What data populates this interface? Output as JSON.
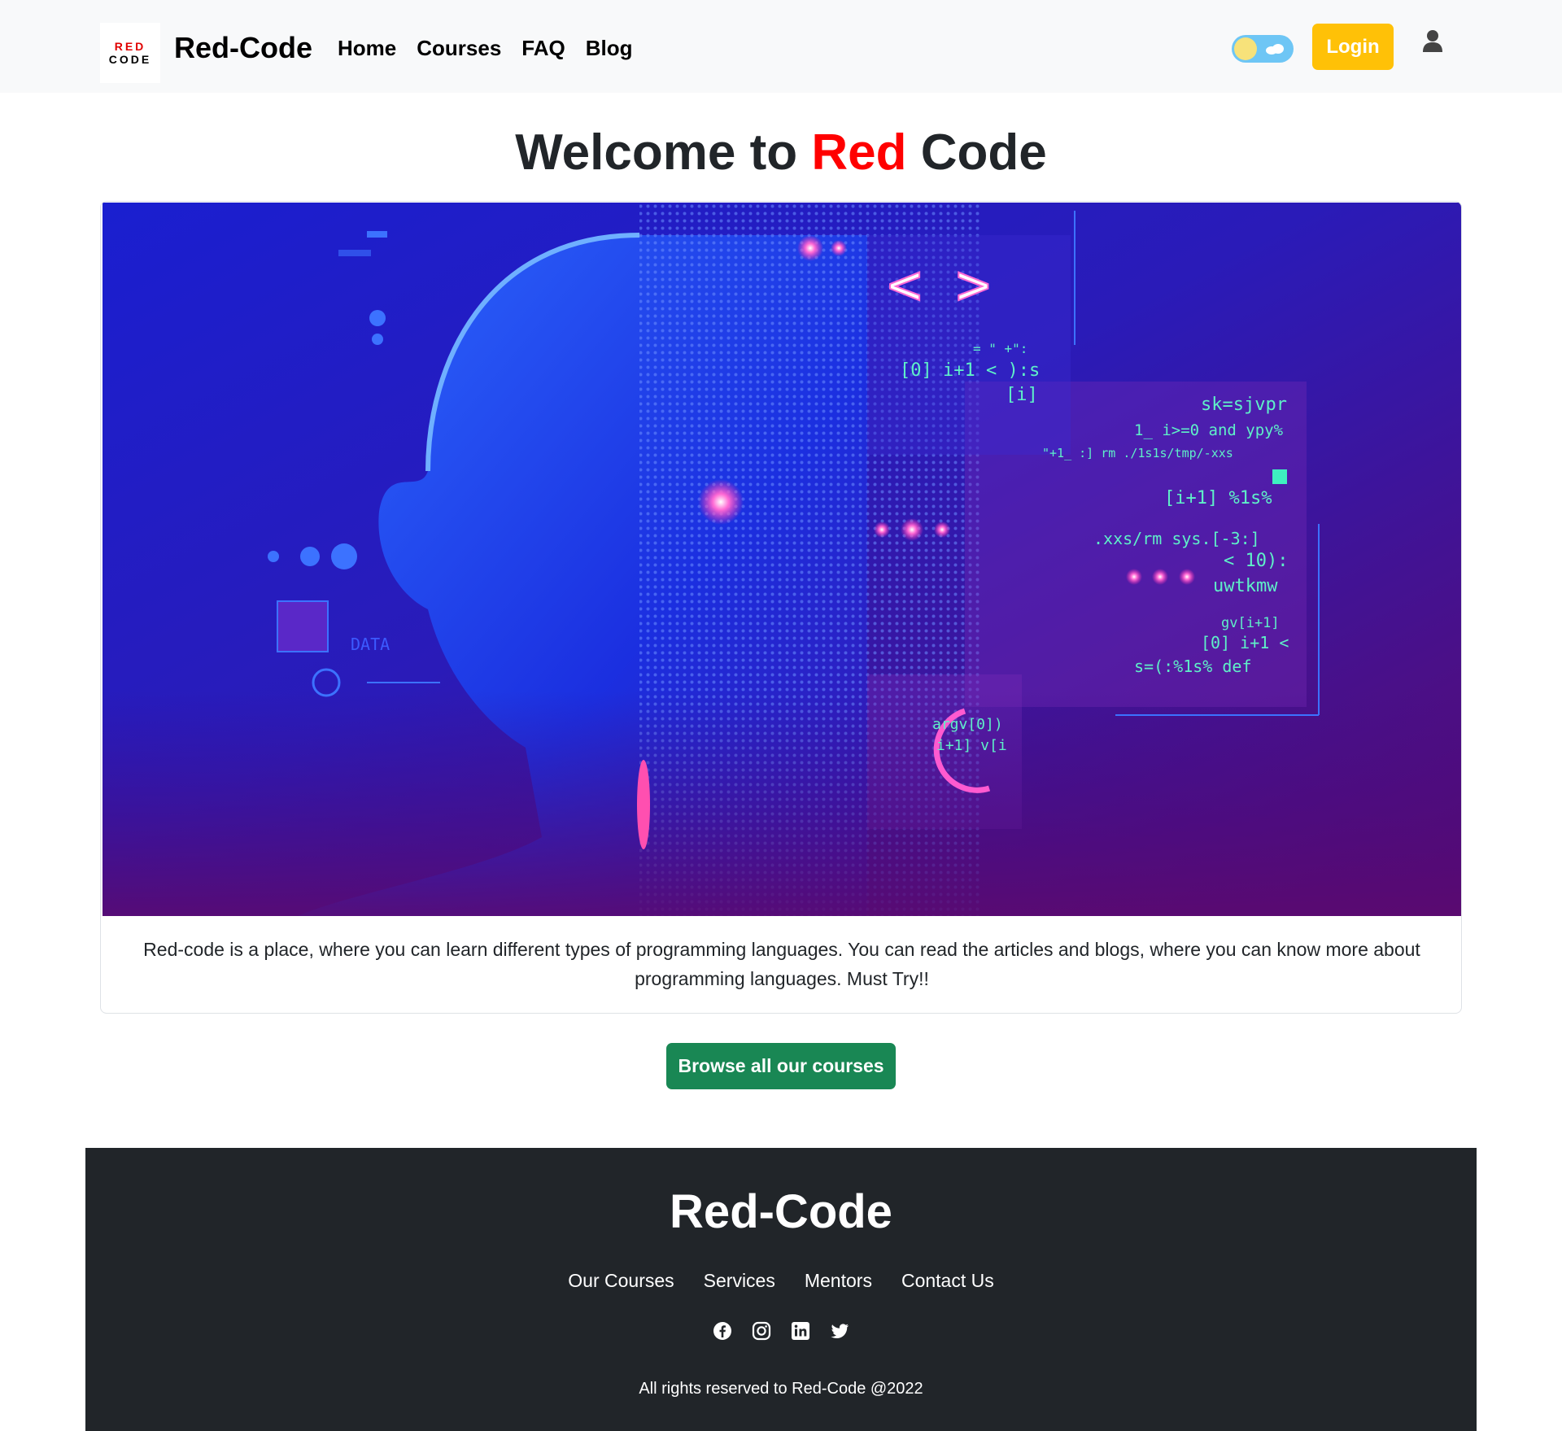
{
  "nav": {
    "logo_top": "RED",
    "logo_bottom": "CODE",
    "brand": "Red-Code",
    "links": [
      "Home",
      "Courses",
      "FAQ",
      "Blog"
    ],
    "login_label": "Login",
    "theme_toggle_icon": "sun-cloud-toggle",
    "user_icon": "user-icon"
  },
  "hero": {
    "title_prefix": "Welcome to ",
    "title_accent": "Red",
    "title_suffix": " Code",
    "accent_color": "#ff0000",
    "image_texts": {
      "brackets": "< >",
      "line1": "= \" +\":",
      "line2": "[0] i+1 < ):s",
      "line3": "[i]",
      "line4": "sk=sjvpr",
      "line5": "1_ i>=0 and  ypy%",
      "line6": "\"+1_ :]  rm ./1s1s/tmp/-xxs",
      "line7": "[i+1]  %1s%",
      "line8": ".xxs/rm  sys.[-3:]",
      "line9": "< 10):",
      "line10": "uwtkmw",
      "line11": "gv[i+1]",
      "line12": "[0] i+1 <",
      "line13": "s=(:%1s%   def",
      "line14": "argv[0])",
      "line15": "i+1] v[i",
      "data_label": "DATA"
    },
    "description": "Red-code is a place, where you can learn different types of programming languages. You can read the articles and blogs, where you can know more about programming languages. Must Try!!",
    "browse_label": "Browse all our courses"
  },
  "footer": {
    "brand": "Red-Code",
    "links": [
      "Our Courses",
      "Services",
      "Mentors",
      "Contact Us"
    ],
    "socials": [
      "facebook-icon",
      "instagram-icon",
      "linkedin-icon",
      "twitter-icon"
    ],
    "copyright": "All rights reserved to Red-Code @2022"
  },
  "colors": {
    "login": "#ffc107",
    "browse": "#198754",
    "footer_bg": "#212529",
    "navbar_bg": "#f8f9fa"
  }
}
